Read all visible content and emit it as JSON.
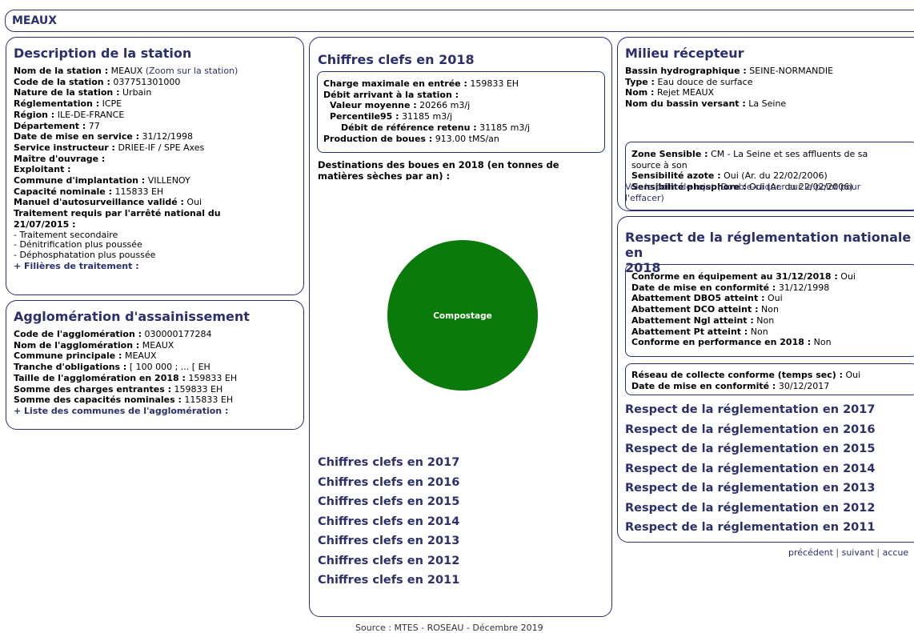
{
  "header": {
    "title": "MEAUX"
  },
  "station": {
    "title": "Description de la station",
    "rows": [
      {
        "label": "Nom de la station :",
        "value": "MEAUX",
        "link": "(Zoom sur la station)"
      },
      {
        "label": "Code de la station :",
        "value": "037751301000"
      },
      {
        "label": "Nature de la station :",
        "value": "Urbain"
      },
      {
        "label": "Réglementation :",
        "value": "ICPE"
      },
      {
        "label": "Région :",
        "value": "ILE-DE-FRANCE"
      },
      {
        "label": "Département :",
        "value": "77"
      },
      {
        "label": "Date de mise en service :",
        "value": "31/12/1998"
      },
      {
        "label": "Service instructeur :",
        "value": "DRIEE-IF / SPE Axes"
      },
      {
        "label": "Maître d'ouvrage :",
        "value": ""
      },
      {
        "label": "Exploitant :",
        "value": ""
      },
      {
        "label": "Commune d'implantation :",
        "value": "VILLENOY"
      },
      {
        "label": "Capacité nominale :",
        "value": "115833 EH"
      },
      {
        "label": "Manuel d'autosurveillance validé :",
        "value": "Oui"
      }
    ],
    "treatment_title_1": "Traitement requis par l'arrêté national du",
    "treatment_title_2": "21/07/2015  :",
    "treatments": [
      "- Traitement secondaire",
      "- Dénitrification plus poussée",
      "- Déphosphatation plus poussée"
    ],
    "filieres_link": "+ Filières de traitement :"
  },
  "agglo": {
    "title": "Agglomération d'assainissement",
    "rows": [
      {
        "label": "Code de l'agglomération :",
        "value": "030000177284"
      },
      {
        "label": "Nom de l'agglomération :",
        "value": "MEAUX"
      },
      {
        "label": "Commune principale :",
        "value": "MEAUX"
      },
      {
        "label": "Tranche d'obligations :",
        "value": "[ 100 000 ; ... [ EH"
      },
      {
        "label": "Taille de l'agglomération en 2018 :",
        "value": "159833 EH"
      },
      {
        "label": "Somme des charges entrantes :",
        "value": "159833 EH"
      },
      {
        "label": "Somme des capacités nominales :",
        "value": "115833 EH"
      }
    ],
    "communes_link": "+ Liste des communes de l'agglomération :"
  },
  "key_figures": {
    "title": "Chiffres clefs en 2018",
    "charge_label": "Charge maximale en entrée  :",
    "charge_value": "159833 EH",
    "debit_label": "Débit arrivant à la station :",
    "moyenne_label": "Valeur moyenne :",
    "moyenne_value": "20266 m3/j",
    "percentile_label": "Percentile95 :",
    "percentile_value": "31185 m3/j",
    "reference_label": "Débit de référence retenu :",
    "reference_value": "31185 m3/j",
    "boues_label": "Production de boues :",
    "boues_value": "913.00 tMS/an",
    "destinations_line1": "Destinations des boues en 2018 (en tonnes de",
    "destinations_line2": "matières sèches par an) :",
    "pie_label": "Compostage",
    "pie_color": "#0a7a0a",
    "years": [
      "Chiffres clefs en 2017",
      "Chiffres clefs en 2016",
      "Chiffres clefs en 2015",
      "Chiffres clefs en 2014",
      "Chiffres clefs en 2013",
      "Chiffres clefs en 2012",
      "Chiffres clefs en 2011"
    ]
  },
  "milieu": {
    "title": "Milieu récepteur",
    "rows": [
      {
        "label": "Bassin hydrographique :",
        "value": "SEINE-NORMANDIE"
      },
      {
        "label": "Type :",
        "value": "Eau douce de surface"
      },
      {
        "label": "Nom :",
        "value": "Rejet MEAUX"
      },
      {
        "label": "Nom du bassin versant :",
        "value": "La Seine"
      }
    ],
    "zone_label": "Zone Sensible :",
    "zone_value_1": "CM - La Seine et ses affluents de sa",
    "zone_value_2": "source à son",
    "azote_label": "Sensibilité azote :",
    "azote_value": "Oui (Ar. du 22/02/2006)",
    "phosphore_label": "Sensibilité phosphore :",
    "phosphore_value": "Oui (Ar. du 22/02/2006)",
    "rejet_link_1": "Voir le point de rejet (Double-cliquer sur le point pour",
    "rejet_link_2": "l'effacer)"
  },
  "reglementation": {
    "title_1": "Respect de la réglementation nationale en",
    "title_2": "2018",
    "rows": [
      {
        "label": "Conforme en équipement au 31/12/2018 :",
        "value": "Oui"
      },
      {
        "label": "Date de mise en conformité :",
        "value": "31/12/1998"
      },
      {
        "label": "Abattement DBO5 atteint :",
        "value": "Oui"
      },
      {
        "label": "Abattement DCO atteint :",
        "value": "Non"
      },
      {
        "label": "Abattement Ngl atteint :",
        "value": "Non"
      },
      {
        "label": "Abattement Pt atteint :",
        "value": "Non"
      },
      {
        "label": "Conforme en performance en 2018 :",
        "value": "Non"
      }
    ],
    "reseau_label": "Réseau de collecte conforme (temps sec) :",
    "reseau_value": "Oui",
    "reseau_date_label": "Date de mise en conformité :",
    "reseau_date_value": "30/12/2017",
    "years": [
      "Respect de la réglementation en 2017",
      "Respect de la réglementation en 2016",
      "Respect de la réglementation en 2015",
      "Respect de la réglementation en 2014",
      "Respect de la réglementation en 2013",
      "Respect de la réglementation en 2012",
      "Respect de la réglementation en 2011"
    ]
  },
  "pagination": {
    "prev": "précédent",
    "next": "suivant",
    "home": "accue",
    "sep": "|"
  },
  "footer": {
    "source": "Source : MTES - ROSEAU - Décembre 2019"
  }
}
